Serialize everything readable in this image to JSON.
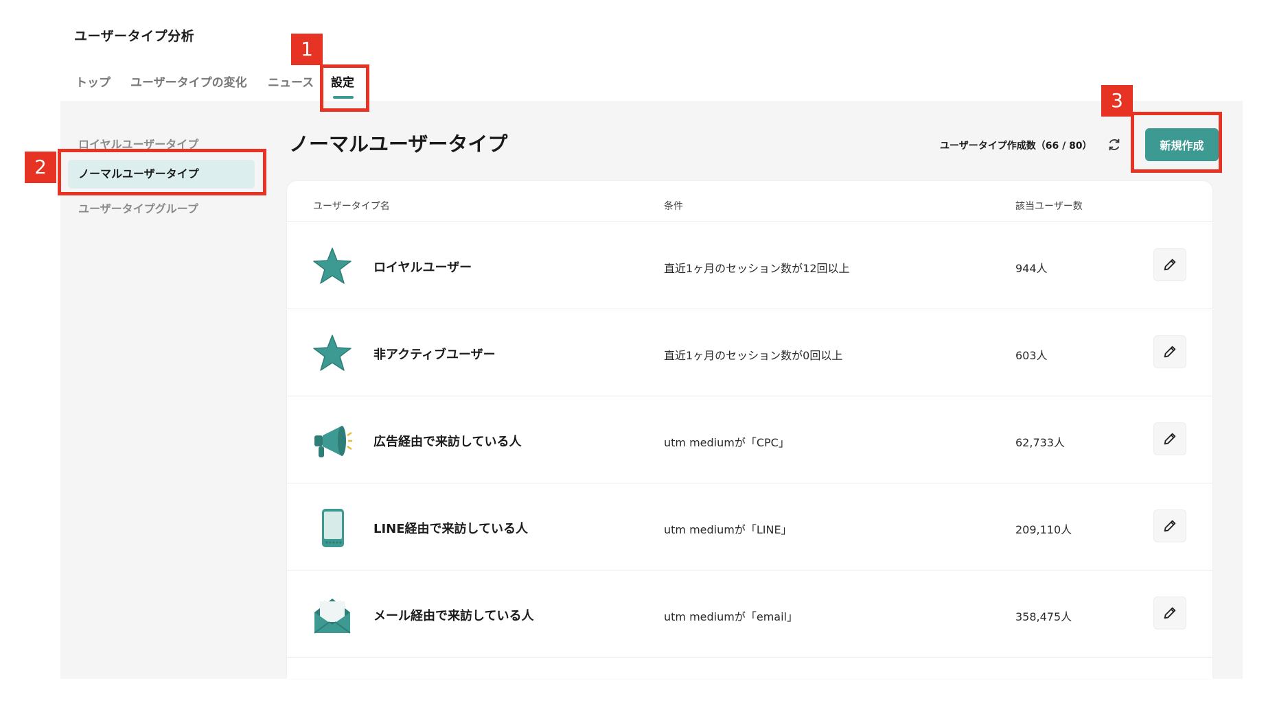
{
  "app_title": "ユーザータイプ分析",
  "tabs": [
    {
      "label": "トップ"
    },
    {
      "label": "ユーザータイプの変化"
    },
    {
      "label": "ニュース"
    },
    {
      "label": "設定",
      "active": true
    }
  ],
  "sidebar": {
    "items": [
      {
        "label": "ロイヤルユーザータイプ"
      },
      {
        "label": "ノーマルユーザータイプ",
        "active": true
      },
      {
        "label": "ユーザータイプグループ"
      }
    ]
  },
  "header": {
    "title": "ノーマルユーザータイプ",
    "count_label": "ユーザータイプ作成数（66 / 80）",
    "refresh_icon": "refresh-icon",
    "new_button_label": "新規作成"
  },
  "table": {
    "columns": [
      "ユーザータイプ名",
      "条件",
      "該当ユーザー数"
    ],
    "rows": [
      {
        "icon": "star-icon",
        "name": "ロイヤルユーザー",
        "condition": "直近1ヶ月のセッション数が12回以上",
        "count": "944人"
      },
      {
        "icon": "star-icon",
        "name": "非アクティブユーザー",
        "condition": "直近1ヶ月のセッション数が0回以上",
        "count": "603人"
      },
      {
        "icon": "megaphone-icon",
        "name": "広告経由で来訪している人",
        "condition": "utm mediumが「CPC」",
        "count": "62,733人"
      },
      {
        "icon": "smartphone-icon",
        "name": "LINE経由で来訪している人",
        "condition": "utm mediumが「LINE」",
        "count": "209,110人"
      },
      {
        "icon": "envelope-icon",
        "name": "メール経由で来訪している人",
        "condition": "utm mediumが「email」",
        "count": "358,475人"
      }
    ]
  },
  "annotations": [
    {
      "number": "1"
    },
    {
      "number": "2"
    },
    {
      "number": "3"
    }
  ],
  "colors": {
    "accent": "#3c9a92",
    "annotation": "#e63323",
    "sidebar_active_bg": "#dcefee",
    "main_bg": "#f5f5f5"
  }
}
